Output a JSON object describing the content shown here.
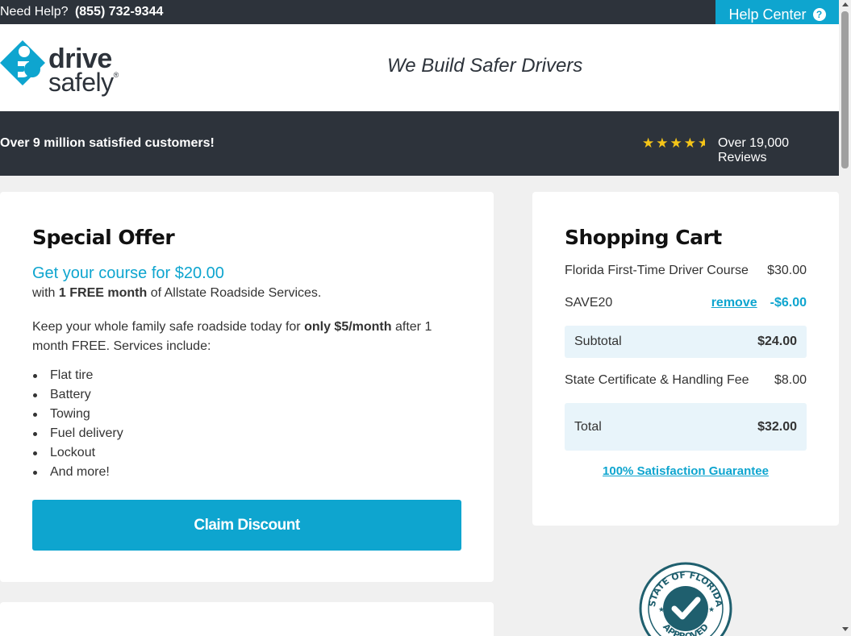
{
  "topbar": {
    "help_text": "Need Help?",
    "phone": "(855) 732-9344",
    "help_center_label": "Help Center",
    "help_icon_glyph": "?"
  },
  "header": {
    "logo_word1": "drive",
    "logo_word2": "safely",
    "logo_registered": "®",
    "tagline": "We Build Safer Drivers"
  },
  "banner": {
    "customers": "Over 9 million satisfied customers!",
    "rating_stars": 4.5,
    "reviews": "Over 19,000 Reviews"
  },
  "offer": {
    "title": "Special Offer",
    "price_line": "Get your course for $20.00",
    "with_prefix": "with ",
    "with_bold": "1 FREE month",
    "with_suffix": " of Allstate Roadside Services.",
    "desc_prefix": "Keep your whole family safe roadside today for ",
    "desc_bold": "only $5/month",
    "desc_suffix": " after 1 month FREE. Services include:",
    "services": [
      "Flat tire",
      "Battery",
      "Towing",
      "Fuel delivery",
      "Lockout",
      "And more!"
    ],
    "claim_label": "Claim Discount"
  },
  "cart": {
    "title": "Shopping Cart",
    "course_name": "Florida First-Time Driver Course",
    "course_price": "$30.00",
    "promo_code": "SAVE20",
    "remove_label": "remove",
    "promo_discount": "-$6.00",
    "subtotal_label": "Subtotal",
    "subtotal_value": "$24.00",
    "fee_label": "State Certificate & Handling Fee",
    "fee_value": "$8.00",
    "total_label": "Total",
    "total_value": "$32.00",
    "guarantee_label": "100% Satisfaction Guarantee"
  },
  "seal": {
    "top_text": "STATE OF FLORIDA",
    "bottom_text": "APPROVED"
  },
  "colors": {
    "accent": "#0ea5cf",
    "dark": "#2d333b",
    "star": "#f5c518",
    "shade": "#e8f4fa"
  }
}
